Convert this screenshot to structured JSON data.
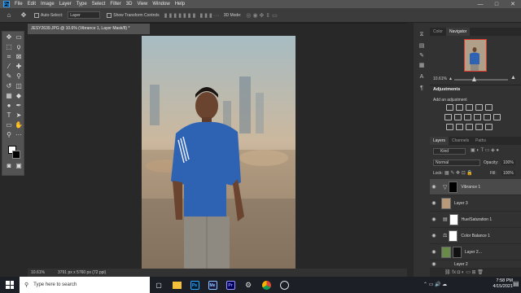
{
  "menubar": {
    "logo": "Ps",
    "items": [
      "File",
      "Edit",
      "Image",
      "Layer",
      "Type",
      "Select",
      "Filter",
      "3D",
      "View",
      "Window",
      "Help"
    ]
  },
  "window_controls": {
    "minimize": "—",
    "maximize": "□",
    "close": "✕"
  },
  "options_bar": {
    "auto_select_label": "Auto-Select:",
    "auto_select_value": "Layer",
    "show_transform_label": "Show Transform Controls",
    "mode_label": "3D Mode:"
  },
  "document": {
    "tab_title": "JESY2639.JPG @ 10.6% (Vibrance 1, Layer Mask/8) *",
    "zoom": "10.61%",
    "dimensions": "3791 px x 5760 px (72 ppi)"
  },
  "panels": {
    "color_tab": "Color",
    "navigator_tab": "Navigator",
    "navigator_zoom": "10.61%",
    "adjustments_title": "Adjustments",
    "add_adjustment": "Add an adjustment",
    "layers_tab": "Layers",
    "channels_tab": "Channels",
    "paths_tab": "Paths",
    "kind_label": "Kind",
    "blend_mode": "Normal",
    "opacity_label": "Opacity:",
    "opacity_value": "100%",
    "lock_label": "Lock:",
    "fill_label": "Fill:",
    "fill_value": "100%"
  },
  "layers": [
    {
      "name": "Vibrance 1",
      "selected": true
    },
    {
      "name": "Layer 3",
      "selected": false
    },
    {
      "name": "Hue/Saturation 1",
      "selected": false
    },
    {
      "name": "Color Balance 1",
      "selected": false
    },
    {
      "name": "Layer 2...",
      "selected": false
    },
    {
      "name": "Layer 2",
      "selected": false
    }
  ],
  "taskbar": {
    "search_placeholder": "Type here to search",
    "apps": [
      "Ps",
      "Me",
      "Pr"
    ],
    "time": "7:58 PM",
    "date": "4/15/2021"
  },
  "colors": {
    "ps_blue": "#31a8ff",
    "premiere": "#9999ff",
    "media_encoder": "#8cc6ff"
  }
}
